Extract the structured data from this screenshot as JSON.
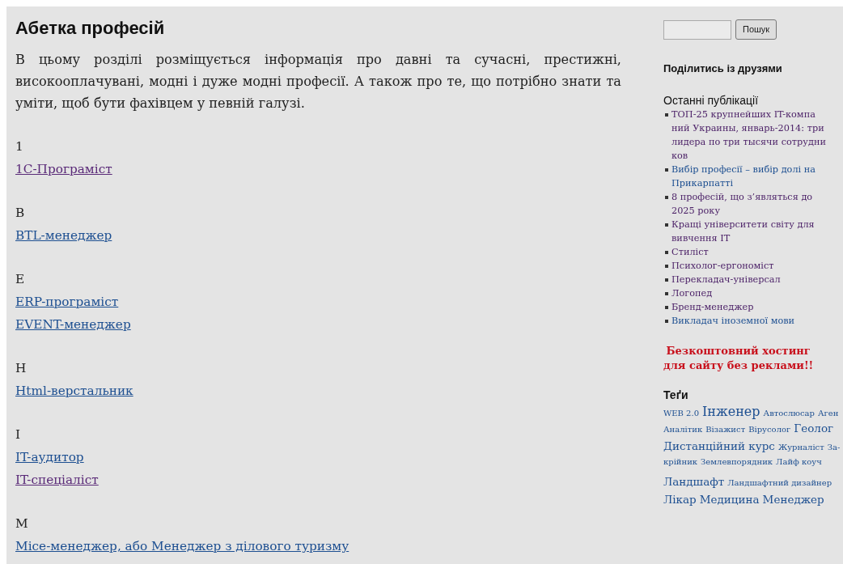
{
  "main": {
    "title": "Абетка професій",
    "intro": "В цьому розділі розміщується інформація про давні та сучасні, престижні, високооплачувані, модні і дуже модні професії. А також про те, що потрібно знати та уміти, щоб бути фахівцем у певній галузі.",
    "groups": [
      {
        "letter": "1",
        "links": [
          {
            "text": "1С-Програміст",
            "visited": true
          }
        ]
      },
      {
        "letter": "B",
        "links": [
          {
            "text": "BTL-менеджер",
            "visited": false
          }
        ]
      },
      {
        "letter": "E",
        "links": [
          {
            "text": "ERP-програміст",
            "visited": false
          },
          {
            "text": "EVENT-менеджер",
            "visited": false
          }
        ]
      },
      {
        "letter": "H",
        "links": [
          {
            "text": "Html-верстальник",
            "visited": false
          }
        ]
      },
      {
        "letter": "I",
        "links": [
          {
            "text": "IT-аудитор",
            "visited": false
          },
          {
            "text": "IT-спеціаліст",
            "visited": true
          }
        ]
      },
      {
        "letter": "M",
        "links": [
          {
            "text": "Місе-менеджер, або Менеджер з ділового туризму",
            "visited": false
          }
        ]
      }
    ]
  },
  "sidebar": {
    "search_button": "Пошук",
    "share_title": "Поділитись із друзями",
    "recent_title": "Останні публікації",
    "recent": [
      {
        "lines": [
          "ТОП-25 крупнейших IT-компа",
          "ний Украины, январь-2014: три",
          "лидера по три тысячи сотрудни",
          "ков"
        ],
        "visited": true
      },
      {
        "lines": [
          "Вибір професії – вибір долі на",
          "Прикарпатті"
        ],
        "visited": false
      },
      {
        "lines": [
          "8 професій, що з’являться до",
          "2025 року"
        ],
        "visited": true
      },
      {
        "lines": [
          "Кращі університети світу для",
          "вивчення IT"
        ],
        "visited": true
      },
      {
        "lines": [
          "Стиліст"
        ],
        "visited": true
      },
      {
        "lines": [
          "Психолог-ергономіст"
        ],
        "visited": true
      },
      {
        "lines": [
          "Перекладач-універсал"
        ],
        "visited": true
      },
      {
        "lines": [
          "Логопед"
        ],
        "visited": true
      },
      {
        "lines": [
          "Бренд-менеджер"
        ],
        "visited": true
      },
      {
        "lines": [
          "Викладач іноземної мови"
        ],
        "visited": false
      }
    ],
    "ad_lines": [
      "Безкоштовний хостинг",
      "для сайту без реклами!!"
    ],
    "tags_title": "Теґи",
    "tag_lines": [
      [
        {
          "text": "WEB 2.0",
          "kind": "small"
        },
        {
          "text": "Інженер",
          "kind": "large"
        },
        {
          "text": "Автослюсар",
          "kind": "small"
        },
        {
          "text": "Аген",
          "kind": "small"
        }
      ],
      [
        {
          "text": "Аналітик",
          "kind": "small"
        },
        {
          "text": "Візажист",
          "kind": "small"
        },
        {
          "text": "Вірусолог",
          "kind": "small"
        },
        {
          "text": "Геолог",
          "kind": "medium"
        }
      ],
      [
        {
          "text": "Дистанційний курс",
          "kind": "medium"
        },
        {
          "text": "Журналіст",
          "kind": "small"
        },
        {
          "text": "За-",
          "kind": "small"
        }
      ],
      [
        {
          "text": "крійник",
          "kind": "small"
        },
        {
          "text": "Землевпорядник",
          "kind": "small"
        },
        {
          "text": "Лайф коуч",
          "kind": "small"
        }
      ],
      [
        {
          "text": "Ландшафт",
          "kind": "medium"
        },
        {
          "text": "Ландшафтний дизайнер",
          "kind": "small"
        }
      ],
      [
        {
          "text": "Лікар",
          "kind": "medium"
        },
        {
          "text": "Медицина",
          "kind": "medium"
        },
        {
          "text": "Менеджер",
          "kind": "medium"
        }
      ]
    ]
  }
}
